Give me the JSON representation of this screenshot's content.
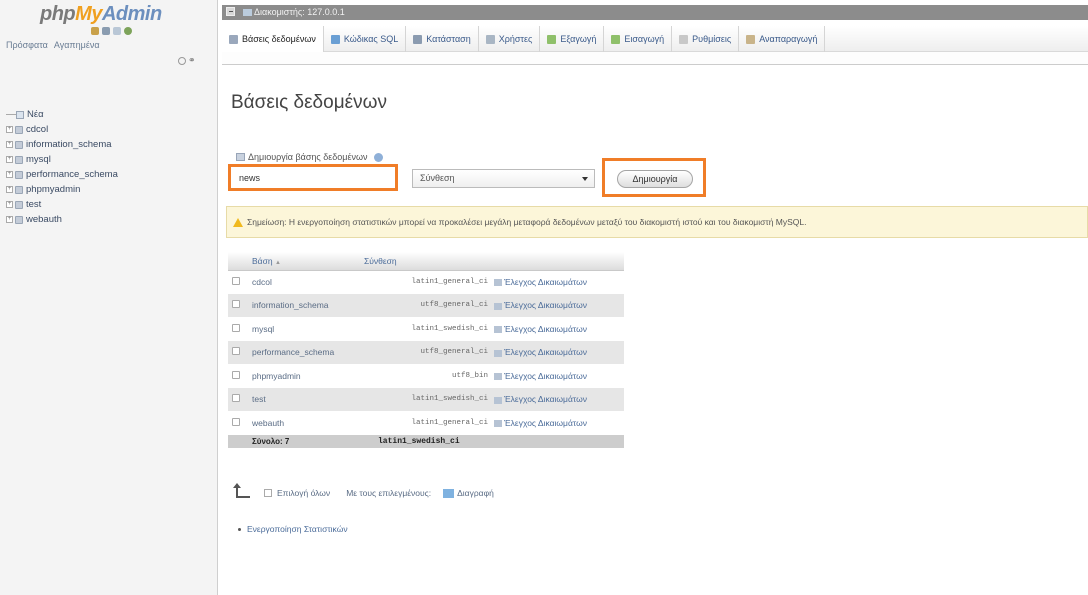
{
  "nav": {
    "logo": {
      "php": "php",
      "my": "My",
      "admin": "Admin"
    },
    "tabs": [
      "Πρόσφατα",
      "Αγαπημένα"
    ],
    "tree": [
      {
        "label": "Νέα",
        "type": "new"
      },
      {
        "label": "cdcol",
        "type": "db"
      },
      {
        "label": "information_schema",
        "type": "db"
      },
      {
        "label": "mysql",
        "type": "db"
      },
      {
        "label": "performance_schema",
        "type": "db"
      },
      {
        "label": "phpmyadmin",
        "type": "db"
      },
      {
        "label": "test",
        "type": "db"
      },
      {
        "label": "webauth",
        "type": "db"
      }
    ]
  },
  "serverbar": {
    "label": "Διακομιστής: 127.0.0.1"
  },
  "menu": {
    "tabs": [
      {
        "label": "Βάσεις δεδομένων",
        "icon": "database-icon",
        "color": "#9aa8bc",
        "active": true
      },
      {
        "label": "Κώδικας SQL",
        "icon": "sql-icon",
        "color": "#6a9fd4"
      },
      {
        "label": "Κατάσταση",
        "icon": "status-icon",
        "color": "#8b9bb0"
      },
      {
        "label": "Χρήστες",
        "icon": "users-icon",
        "color": "#a9b6c4"
      },
      {
        "label": "Εξαγωγή",
        "icon": "export-icon",
        "color": "#8fc06a"
      },
      {
        "label": "Εισαγωγή",
        "icon": "import-icon",
        "color": "#8fc06a"
      },
      {
        "label": "Ρυθμίσεις",
        "icon": "settings-icon",
        "color": "#c8c8c8"
      },
      {
        "label": "Αναπαραγωγή",
        "icon": "replication-icon",
        "color": "#c9b48a"
      }
    ]
  },
  "main": {
    "title": "Βάσεις δεδομένων",
    "create_label": "Δημιουργία βάσης δεδομένων",
    "db_name_value": "news",
    "collation_placeholder": "Σύνθεση",
    "create_button": "Δημιουργία",
    "notice": "Σημείωση: Η ενεργοποίηση στατιστικών μπορεί να προκαλέσει μεγάλη μεταφορά δεδομένων μεταξύ του διακομιστή ιστού και του διακομιστή MySQL.",
    "table": {
      "headers": {
        "db": "Βάση",
        "sort_arrow": "▲",
        "collation": "Σύνθεση"
      },
      "rows": [
        {
          "db": "cdcol",
          "collation": "latin1_general_ci",
          "priv": "Έλεγχος Δικαιωμάτων"
        },
        {
          "db": "information_schema",
          "collation": "utf8_general_ci",
          "priv": "Έλεγχος Δικαιωμάτων"
        },
        {
          "db": "mysql",
          "collation": "latin1_swedish_ci",
          "priv": "Έλεγχος Δικαιωμάτων"
        },
        {
          "db": "performance_schema",
          "collation": "utf8_general_ci",
          "priv": "Έλεγχος Δικαιωμάτων"
        },
        {
          "db": "phpmyadmin",
          "collation": "utf8_bin",
          "priv": "Έλεγχος Δικαιωμάτων"
        },
        {
          "db": "test",
          "collation": "latin1_swedish_ci",
          "priv": "Έλεγχος Δικαιωμάτων"
        },
        {
          "db": "webauth",
          "collation": "latin1_general_ci",
          "priv": "Έλεγχος Δικαιωμάτων"
        }
      ],
      "total_label": "Σύνολο: 7",
      "total_collation": "latin1_swedish_ci"
    },
    "bulk": {
      "select_all": "Επιλογή όλων",
      "with_selected": "Με τους επιλεγμένους:",
      "delete": "Διαγραφή"
    },
    "stats_link": "Ενεργοποίηση Στατιστικών"
  },
  "colors": {
    "highlight": "#f07d28",
    "link": "#4a6b99",
    "notice_bg": "#fcf6d9"
  }
}
